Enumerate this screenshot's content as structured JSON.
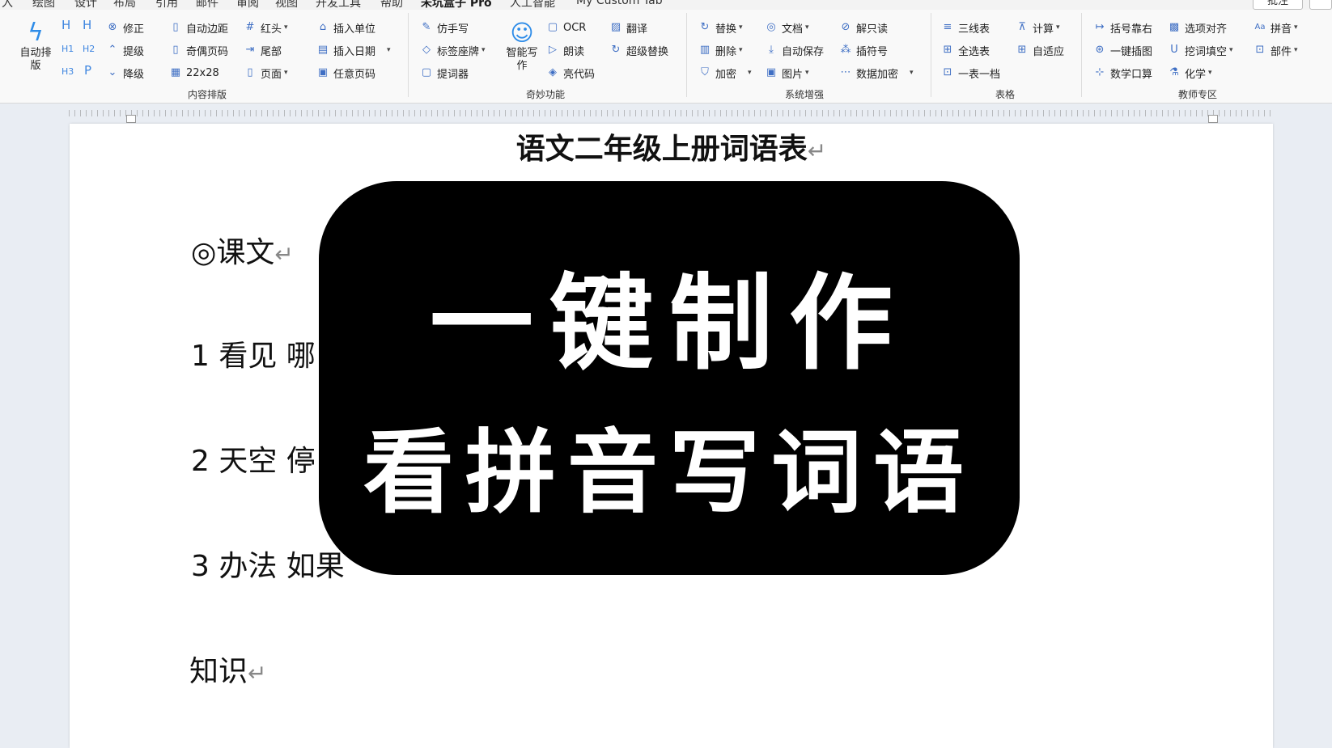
{
  "menu": {
    "tabs": [
      "入",
      "绘图",
      "设计",
      "布局",
      "引用",
      "邮件",
      "审阅",
      "视图",
      "开发工具",
      "帮助",
      "未坑盒子 Pro",
      "人工智能",
      "My Custom Tab"
    ],
    "active_tab": "未坑盒子 Pro",
    "comment_button": "批注"
  },
  "ribbon": {
    "content_layout": {
      "label": "内容排版",
      "auto_layout": "自动排版",
      "h_buttons": [
        "H",
        "H",
        "H1",
        "H2",
        "H3",
        "P"
      ],
      "items": [
        "修正",
        "提级",
        "降级",
        "自动边距",
        "奇偶页码",
        "22x28",
        "红头",
        "尾部",
        "页面",
        "插入单位",
        "插入日期",
        "任意页码"
      ]
    },
    "magic": {
      "label": "奇妙功能",
      "items": [
        "仿手写",
        "标签座牌",
        "提词器",
        "OCR",
        "朗读",
        "亮代码",
        "翻译",
        "超级替换"
      ],
      "smart_write": "智能写作"
    },
    "system": {
      "label": "系统增强",
      "items": [
        "替换",
        "删除",
        "加密",
        "文档",
        "自动保存",
        "图片",
        "解只读",
        "插符号",
        "数据加密"
      ]
    },
    "table": {
      "label": "表格",
      "items": [
        "三线表",
        "全选表",
        "一表一档",
        "计算",
        "自适应"
      ]
    },
    "teacher": {
      "label": "教师专区",
      "items": [
        "括号靠右",
        "一键插图",
        "数学口算",
        "选项对齐",
        "挖词填空",
        "化学",
        "拼音",
        "部件"
      ]
    }
  },
  "document": {
    "title": "语文二年级上册词语表",
    "section_heading": "◎课文",
    "lines": [
      "1 看见 哪",
      "2 天空 停",
      "3 办法 如果"
    ],
    "knowledge_heading": "知识"
  },
  "banner": {
    "line1": "一键制作",
    "line2": "看拼音写词语"
  },
  "colors": {
    "ribbon_icon": "#3f6fc4",
    "h_icon": "#3f86e0",
    "banner_bg": "#000000",
    "banner_text": "#ffffff"
  }
}
